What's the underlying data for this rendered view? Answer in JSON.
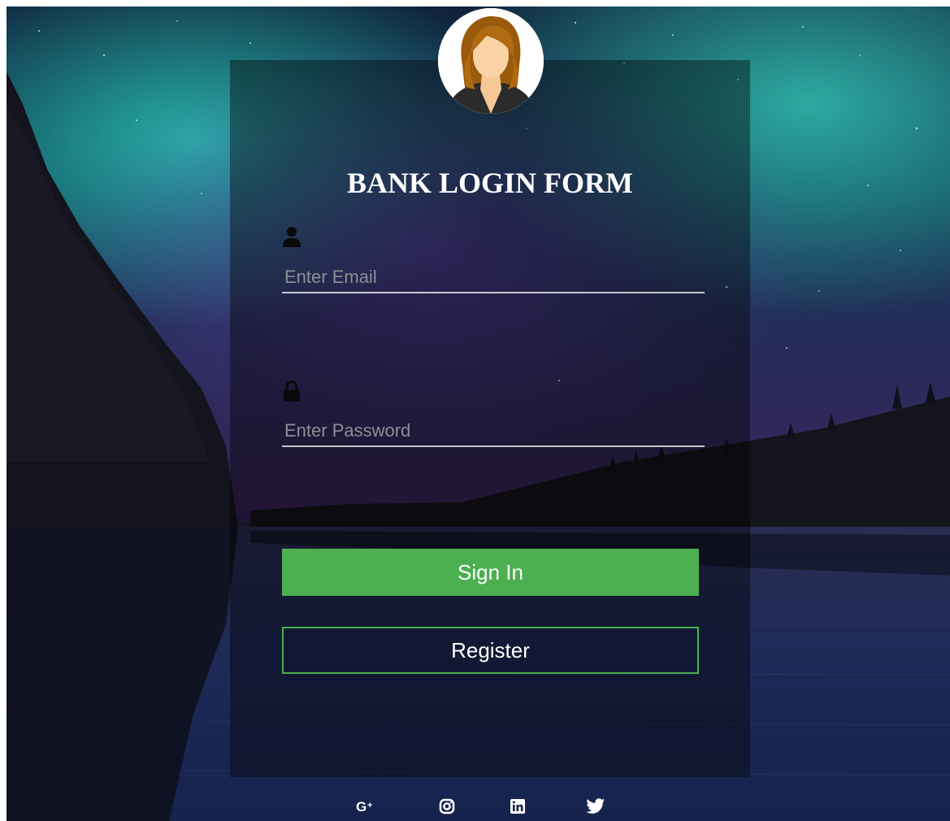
{
  "form": {
    "title": "BANK LOGIN FORM",
    "email_placeholder": "Enter Email",
    "password_placeholder": "Enter Password",
    "signin_label": "Sign In",
    "register_label": "Register"
  },
  "icons": {
    "user": "user-icon",
    "lock": "lock-icon",
    "avatar": "woman-avatar",
    "social": [
      "google-plus-icon",
      "instagram-icon",
      "linkedin-icon",
      "twitter-icon"
    ]
  },
  "colors": {
    "accent": "#4caf50",
    "title": "#ffffff",
    "placeholder": "#8c8f96",
    "underline": "#c8c8cc"
  }
}
